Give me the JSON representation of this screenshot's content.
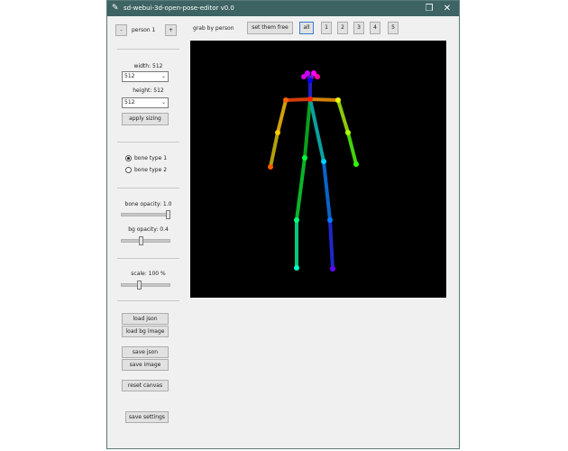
{
  "window": {
    "title": "sd-webui-3d-open-pose-editor v0.0"
  },
  "sidebar": {
    "person_label": "person 1",
    "minus": "-",
    "plus": "+",
    "width_label": "width: 512",
    "width_value": "512",
    "height_label": "height: 512",
    "height_value": "512",
    "apply_sizing": "apply sizing",
    "bone_type_1": "bone type 1",
    "bone_type_2": "bone type 2",
    "bone_opacity_label": "bone opacity: 1.0",
    "bone_opacity": 1.0,
    "bg_opacity_label": "bg opacity: 0.4",
    "bg_opacity": 0.4,
    "scale_label": "scale: 100 %",
    "scale_pos": 0.36,
    "load_json": "load json",
    "load_bg_image": "load bg image",
    "save_json": "save json",
    "save_image": "save image",
    "reset_canvas": "reset canvas",
    "save_settings": "save settings"
  },
  "toolbar": {
    "grab_label": "grab by person",
    "set_them_free": "set them free",
    "all": "all",
    "persons": [
      "1",
      "2",
      "3",
      "4",
      "5"
    ]
  },
  "colors": {
    "titlebar": "#3e6363",
    "canvas": "#000000",
    "head": "#c81ed2"
  }
}
